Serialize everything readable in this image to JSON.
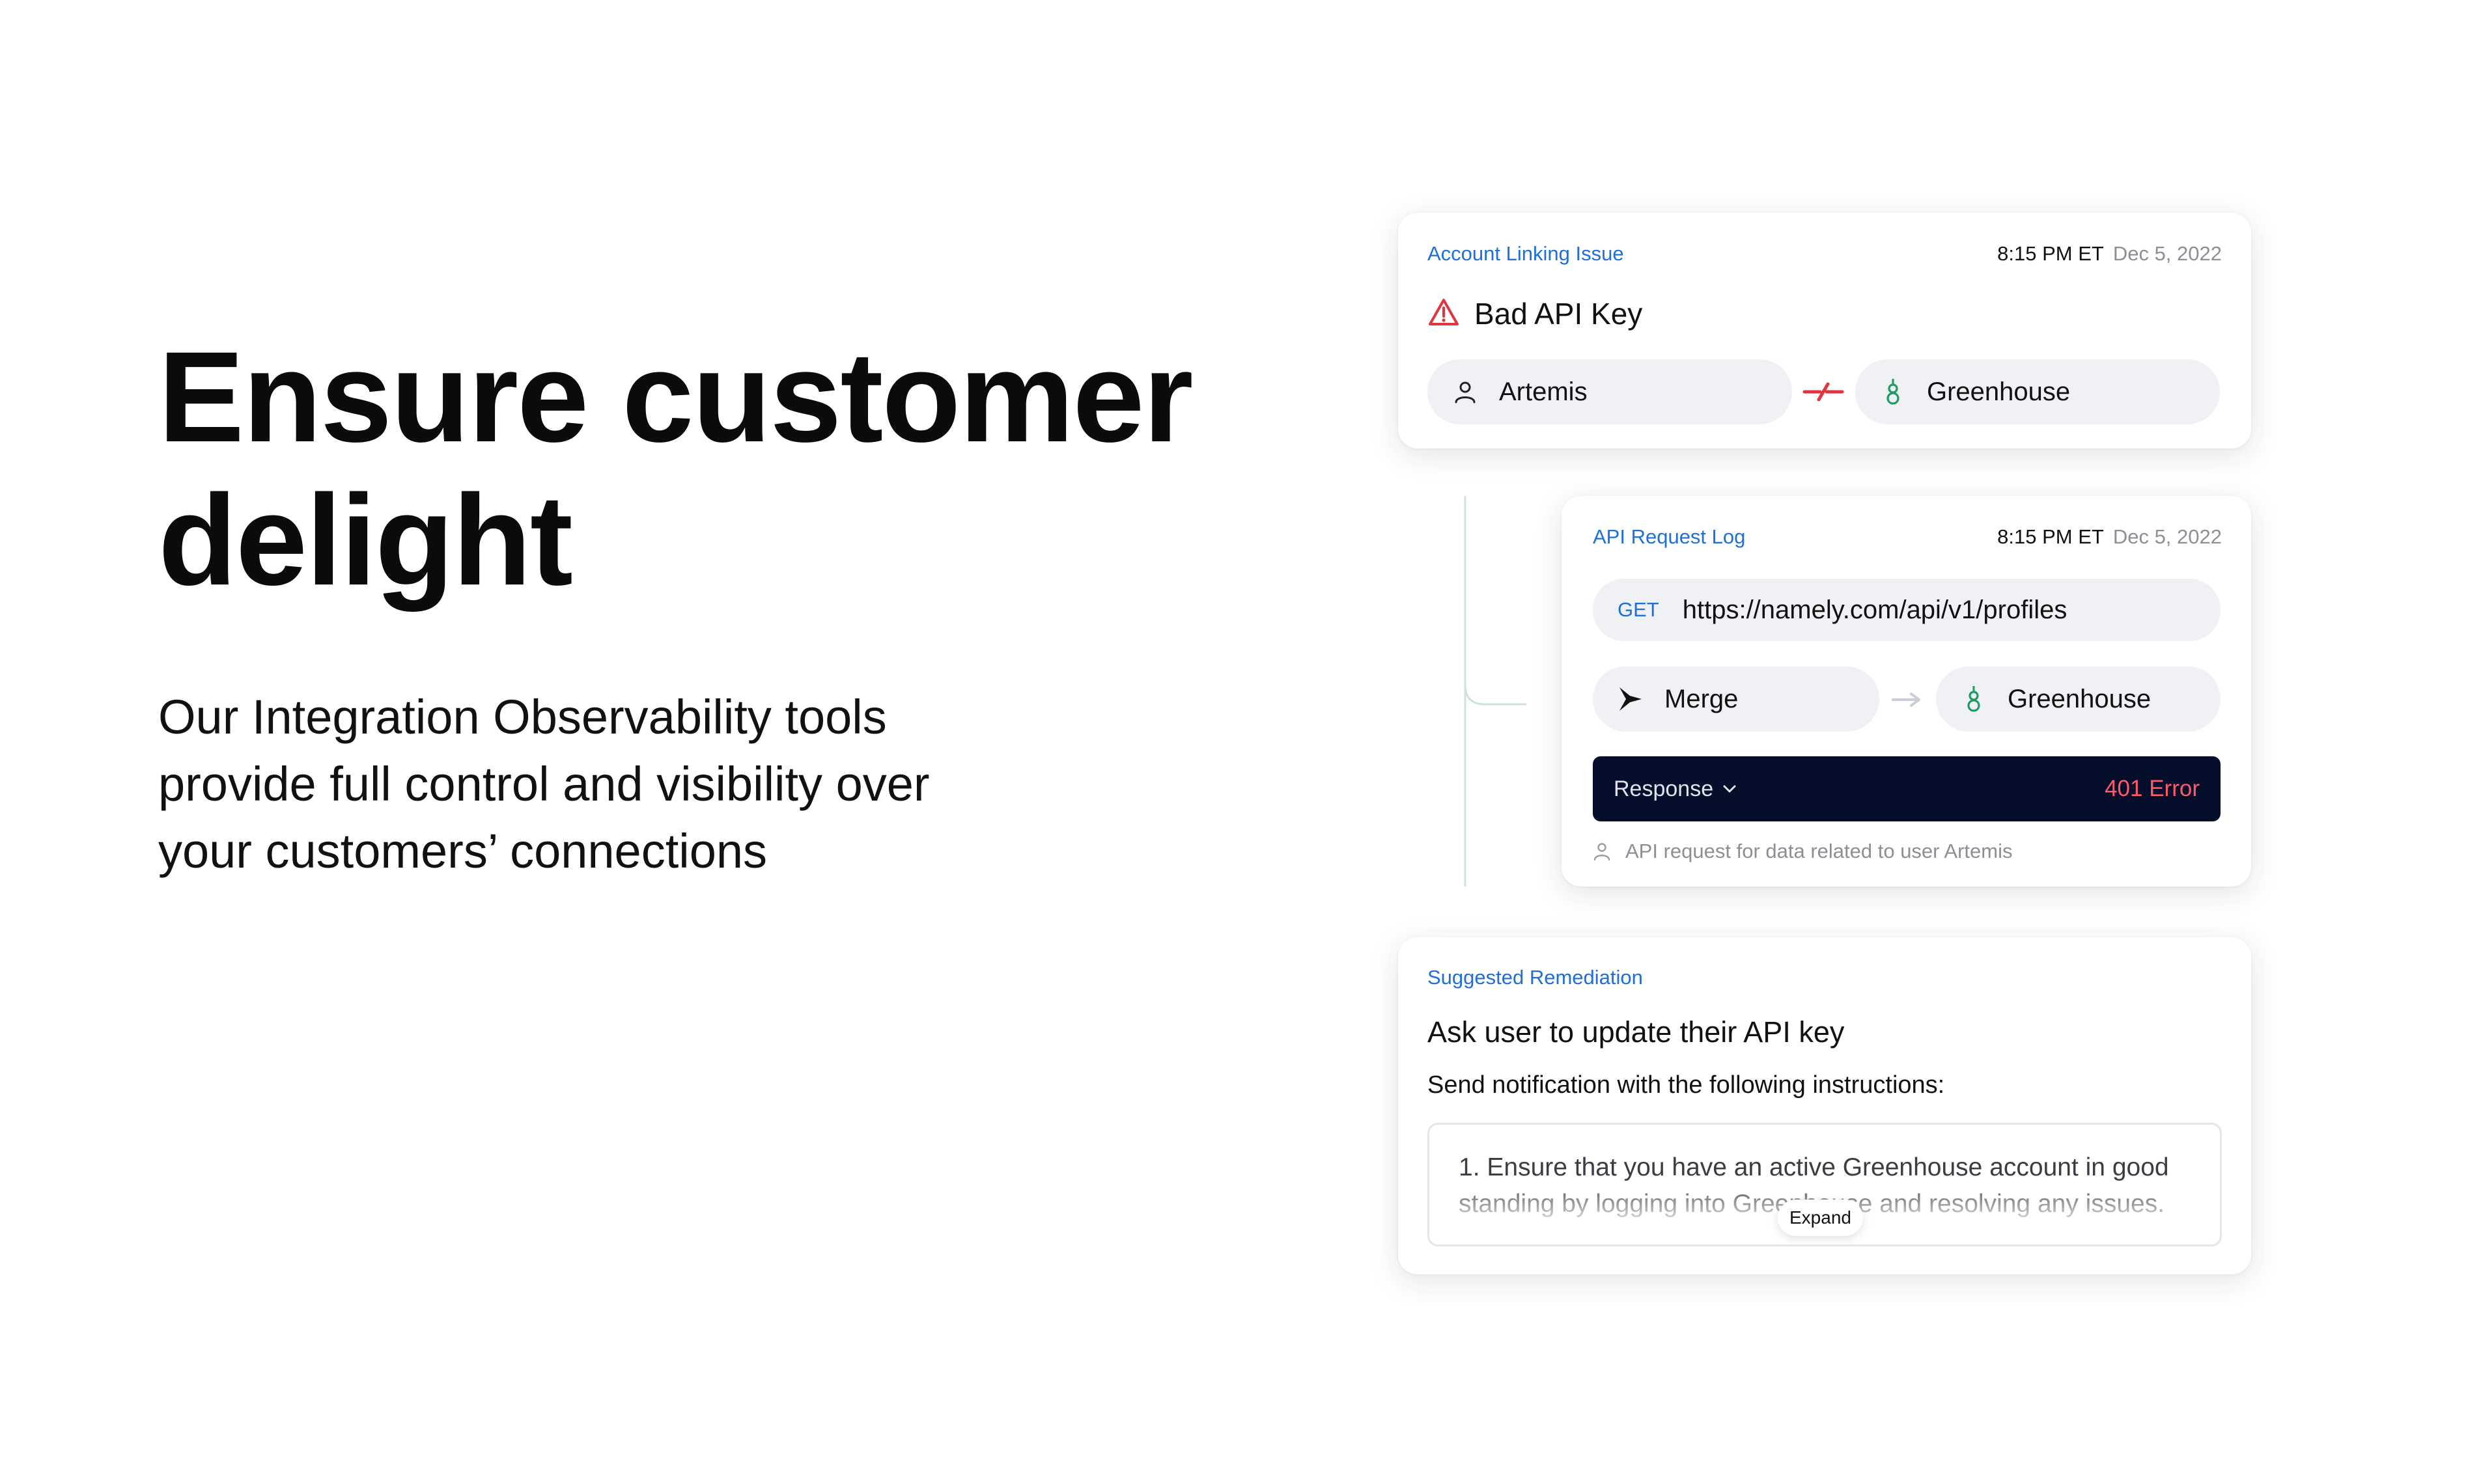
{
  "hero": {
    "title_line1": "Ensure customer",
    "title_line2": "delight",
    "subtitle_line1": "Our Integration Observability tools",
    "subtitle_line2": "provide full control and visibility over",
    "subtitle_line3": "your customers’ connections"
  },
  "issue_card": {
    "eyebrow": "Account Linking Issue",
    "time": "8:15 PM ET",
    "date": "Dec 5, 2022",
    "title": "Bad API Key",
    "user_label": "Artemis",
    "integration_label": "Greenhouse",
    "icons": {
      "alert": "warning-triangle-icon",
      "user": "user-icon",
      "integration": "greenhouse-logo-icon",
      "link": "broken-link-icon"
    }
  },
  "log_card": {
    "eyebrow": "API Request Log",
    "time": "8:15 PM ET",
    "date": "Dec 5, 2022",
    "method": "GET",
    "url": "https://namely.com/api/v1/profiles",
    "source_label": "Merge",
    "target_label": "Greenhouse",
    "response_label": "Response",
    "response_status": "401 Error",
    "footnote": "API request for data related to user Artemis"
  },
  "remediation_card": {
    "eyebrow": "Suggested Remediation",
    "title": "Ask user to update their API key",
    "instruction": "Send notification with the following instructions:",
    "step_number": "1.",
    "step_text": "Ensure that you have an active Greenhouse account in good standing by logging into Greenhouse and resolving any issues.",
    "expand_label": "Expand"
  },
  "colors": {
    "accent_blue": "#1e6fd9",
    "error_red": "#ff5a6a",
    "alert_red": "#e0343f",
    "greenhouse_green": "#1f9b63",
    "dark_navy": "#050f2c",
    "pill_gray": "#eff1f4"
  }
}
